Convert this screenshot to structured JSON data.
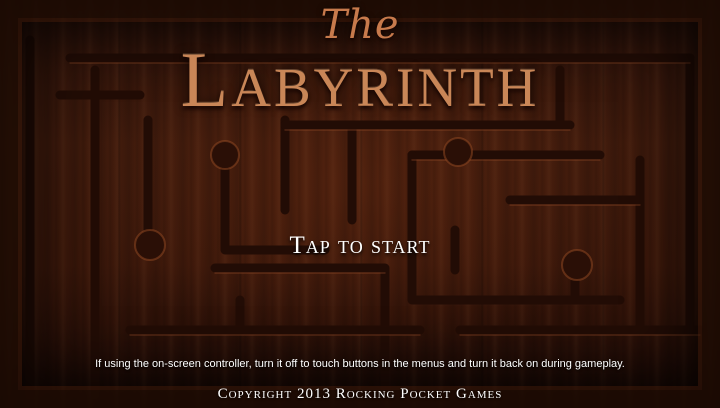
{
  "title": {
    "prefix": "The",
    "main": "Labyrinth"
  },
  "prompt": {
    "start_label": "Tap to start"
  },
  "notice": "If using the on-screen controller, turn it off to touch buttons in the menus and turn it back on during gameplay.",
  "footer": {
    "copyright": "Copyright 2013 Rocking Pocket Games"
  },
  "colors": {
    "title": "#c98657",
    "text": "#ffffff",
    "wood": "#3e1a0c"
  }
}
